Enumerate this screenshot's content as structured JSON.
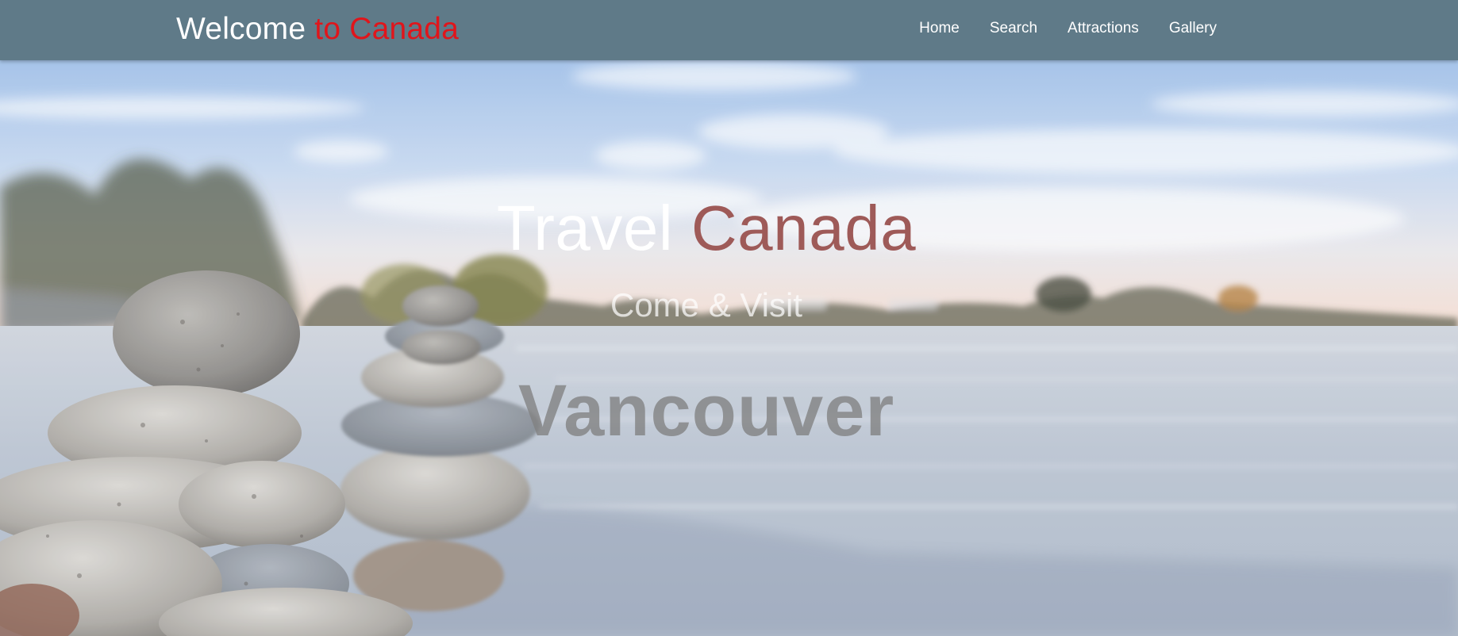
{
  "nav": {
    "brand_main": "Welcome",
    "brand_accent": "to Canada",
    "links": [
      "Home",
      "Search",
      "Attractions",
      "Gallery"
    ]
  },
  "hero": {
    "title_main": "Travel",
    "title_accent": "Canada",
    "subtitle": "Come & Visit",
    "city": "Vancouver"
  },
  "colors": {
    "navbar": "#5f7a88",
    "brand_accent": "#e0151b",
    "title_accent": "#9e5a58"
  }
}
